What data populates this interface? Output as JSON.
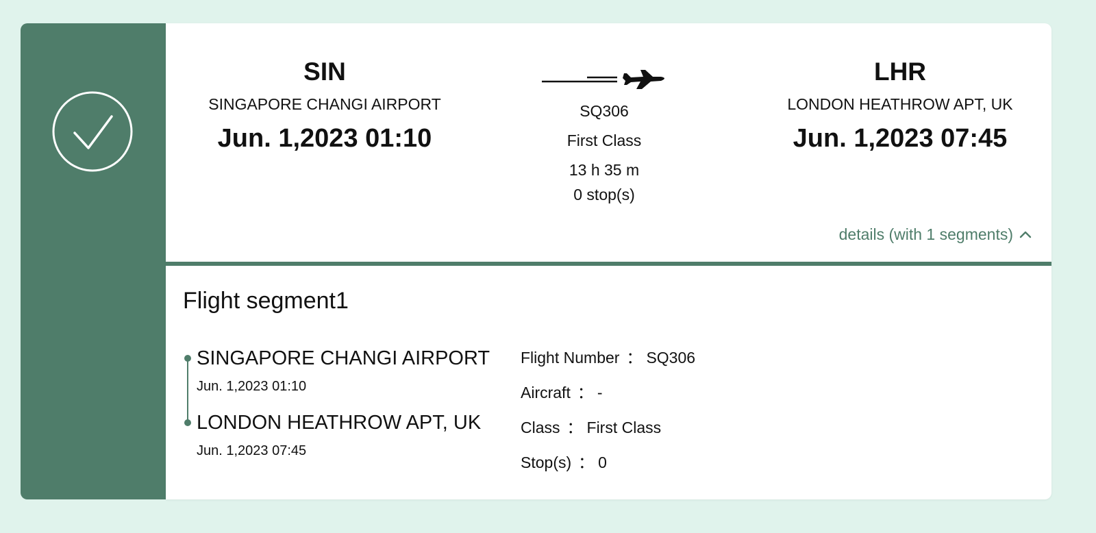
{
  "colors": {
    "accent": "#4f7d6a",
    "background": "#e0f3ec"
  },
  "departure": {
    "code": "SIN",
    "airport": "SINGAPORE CHANGI AIRPORT",
    "datetime": "Jun. 1,2023 01:10"
  },
  "arrival": {
    "code": "LHR",
    "airport": "LONDON HEATHROW APT, UK",
    "datetime": "Jun. 1,2023 07:45"
  },
  "flight": {
    "icon": "airplane-icon",
    "number": "SQ306",
    "class": "First Class",
    "duration": "13 h 35 m",
    "stops": "0 stop(s)"
  },
  "details_toggle": {
    "label": "details (with 1 segments)",
    "icon": "chevron-up-icon"
  },
  "segment": {
    "title": "Flight segment1",
    "from": {
      "airport": "SINGAPORE CHANGI AIRPORT",
      "datetime": "Jun. 1,2023 01:10"
    },
    "to": {
      "airport": "LONDON HEATHROW APT, UK",
      "datetime": "Jun. 1,2023 07:45"
    },
    "info": [
      {
        "label": "Flight Number",
        "value": "SQ306"
      },
      {
        "label": "Aircraft",
        "value": "-"
      },
      {
        "label": "Class",
        "value": "First Class"
      },
      {
        "label": "Stop(s)",
        "value": "0"
      }
    ],
    "separator": "："
  }
}
